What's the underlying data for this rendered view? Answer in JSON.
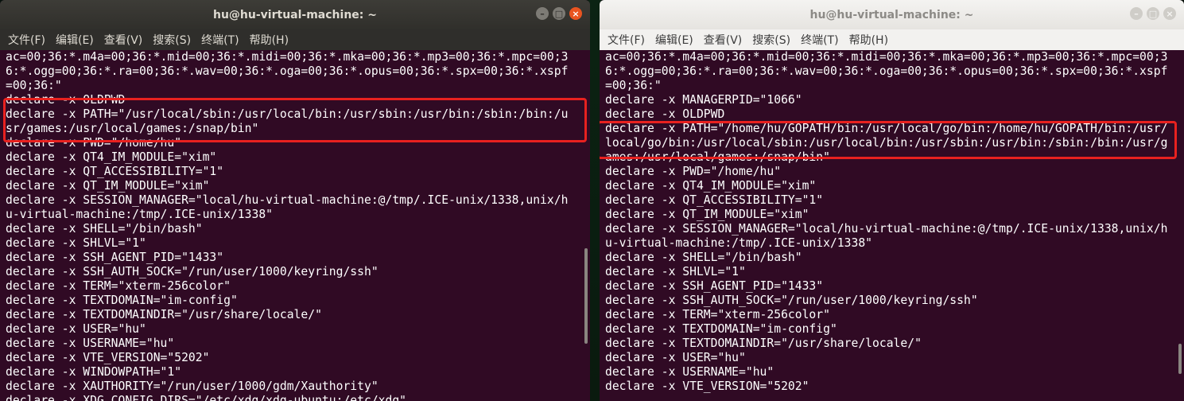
{
  "left": {
    "title": "hu@hu-virtual-machine: ~",
    "menu": [
      "文件(F)",
      "编辑(E)",
      "查看(V)",
      "搜索(S)",
      "终端(T)",
      "帮助(H)"
    ],
    "lines": [
      "ac=00;36:*.m4a=00;36:*.mid=00;36:*.midi=00;36:*.mka=00;36:*.mp3=00;36:*.mpc=00;3",
      "6:*.ogg=00;36:*.ra=00;36:*.wav=00;36:*.oga=00;36:*.opus=00;36:*.spx=00;36:*.xspf",
      "=00;36:\"",
      "declare -x OLDPWD",
      "declare -x PATH=\"/usr/local/sbin:/usr/local/bin:/usr/sbin:/usr/bin:/sbin:/bin:/u",
      "sr/games:/usr/local/games:/snap/bin\"",
      "declare -x PWD=\"/home/hu\"",
      "declare -x QT4_IM_MODULE=\"xim\"",
      "declare -x QT_ACCESSIBILITY=\"1\"",
      "declare -x QT_IM_MODULE=\"xim\"",
      "declare -x SESSION_MANAGER=\"local/hu-virtual-machine:@/tmp/.ICE-unix/1338,unix/h",
      "u-virtual-machine:/tmp/.ICE-unix/1338\"",
      "declare -x SHELL=\"/bin/bash\"",
      "declare -x SHLVL=\"1\"",
      "declare -x SSH_AGENT_PID=\"1433\"",
      "declare -x SSH_AUTH_SOCK=\"/run/user/1000/keyring/ssh\"",
      "declare -x TERM=\"xterm-256color\"",
      "declare -x TEXTDOMAIN=\"im-config\"",
      "declare -x TEXTDOMAINDIR=\"/usr/share/locale/\"",
      "declare -x USER=\"hu\"",
      "declare -x USERNAME=\"hu\"",
      "declare -x VTE_VERSION=\"5202\"",
      "declare -x WINDOWPATH=\"1\"",
      "declare -x XAUTHORITY=\"/run/user/1000/gdm/Xauthority\"",
      "declare -x XDG_CONFIG_DIRS=\"/etc/xdg/xdg-ubuntu:/etc/xdg\""
    ]
  },
  "right": {
    "title": "hu@hu-virtual-machine: ~",
    "menu": [
      "文件(F)",
      "编辑(E)",
      "查看(V)",
      "搜索(S)",
      "终端(T)",
      "帮助(H)"
    ],
    "lines": [
      "ac=00;36:*.m4a=00;36:*.mid=00;36:*.midi=00;36:*.mka=00;36:*.mp3=00;36:*.mpc=00;3",
      "6:*.ogg=00;36:*.ra=00;36:*.wav=00;36:*.oga=00;36:*.opus=00;36:*.spx=00;36:*.xspf",
      "=00;36:\"",
      "declare -x MANAGERPID=\"1066\"",
      "declare -x OLDPWD",
      "declare -x PATH=\"/home/hu/GOPATH/bin:/usr/local/go/bin:/home/hu/GOPATH/bin:/usr/",
      "local/go/bin:/usr/local/sbin:/usr/local/bin:/usr/sbin:/usr/bin:/sbin:/bin:/usr/g",
      "ames:/usr/local/games:/snap/bin\"",
      "declare -x PWD=\"/home/hu\"",
      "declare -x QT4_IM_MODULE=\"xim\"",
      "declare -x QT_ACCESSIBILITY=\"1\"",
      "declare -x QT_IM_MODULE=\"xim\"",
      "declare -x SESSION_MANAGER=\"local/hu-virtual-machine:@/tmp/.ICE-unix/1338,unix/h",
      "u-virtual-machine:/tmp/.ICE-unix/1338\"",
      "declare -x SHELL=\"/bin/bash\"",
      "declare -x SHLVL=\"1\"",
      "declare -x SSH_AGENT_PID=\"1433\"",
      "declare -x SSH_AUTH_SOCK=\"/run/user/1000/keyring/ssh\"",
      "declare -x TERM=\"xterm-256color\"",
      "declare -x TEXTDOMAIN=\"im-config\"",
      "declare -x TEXTDOMAINDIR=\"/usr/share/locale/\"",
      "declare -x USER=\"hu\"",
      "declare -x USERNAME=\"hu\"",
      "declare -x VTE_VERSION=\"5202\""
    ]
  },
  "colors": {
    "terminal_bg": "#300a24",
    "highlight": "#e8211f",
    "close_button": "#e95420"
  }
}
